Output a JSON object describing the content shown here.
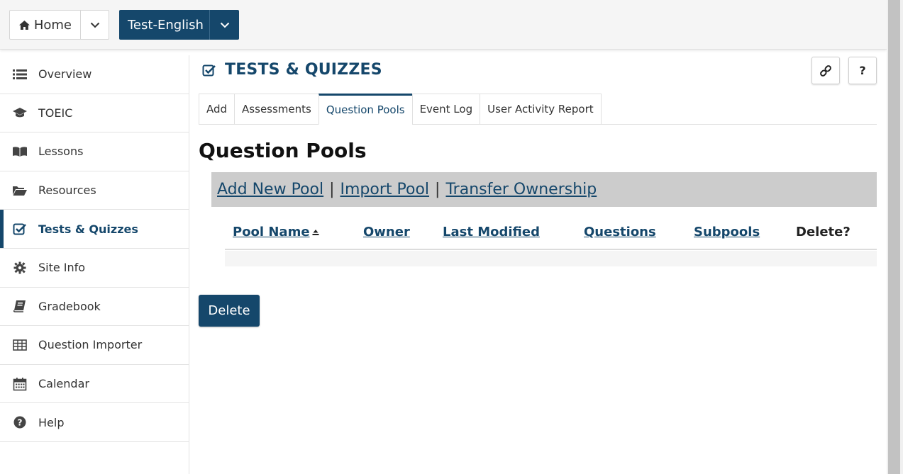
{
  "topbar": {
    "home_label": "Home",
    "site_label": "Test-English"
  },
  "sidebar": {
    "items": [
      {
        "label": "Overview",
        "icon": "list-icon"
      },
      {
        "label": "TOEIC",
        "icon": "graduation-cap-icon"
      },
      {
        "label": "Lessons",
        "icon": "book-open-icon"
      },
      {
        "label": "Resources",
        "icon": "folder-open-icon"
      },
      {
        "label": "Tests & Quizzes",
        "icon": "check-square-icon",
        "active": true
      },
      {
        "label": "Site Info",
        "icon": "gear-icon"
      },
      {
        "label": "Gradebook",
        "icon": "gradebook-icon"
      },
      {
        "label": "Question Importer",
        "icon": "table-icon"
      },
      {
        "label": "Calendar",
        "icon": "calendar-icon"
      },
      {
        "label": "Help",
        "icon": "question-circle-icon"
      }
    ]
  },
  "tool": {
    "title": "TESTS & QUIZZES",
    "help_label": "?"
  },
  "tabs": [
    {
      "label": "Add"
    },
    {
      "label": "Assessments"
    },
    {
      "label": "Question Pools",
      "active": true
    },
    {
      "label": "Event Log"
    },
    {
      "label": "User Activity Report"
    }
  ],
  "page": {
    "title": "Question Pools"
  },
  "actions": {
    "add_new_pool": "Add New Pool",
    "import_pool": "Import Pool",
    "transfer_ownership": "Transfer Ownership",
    "separator": "|"
  },
  "table": {
    "headers": {
      "pool_name": "Pool Name",
      "owner": "Owner",
      "last_modified": "Last Modified",
      "questions": "Questions",
      "subpools": "Subpools",
      "delete": "Delete?"
    }
  },
  "buttons": {
    "delete_label": "Delete"
  },
  "colors": {
    "accent": "#15476b",
    "action_bar_bg": "#cccccc"
  }
}
